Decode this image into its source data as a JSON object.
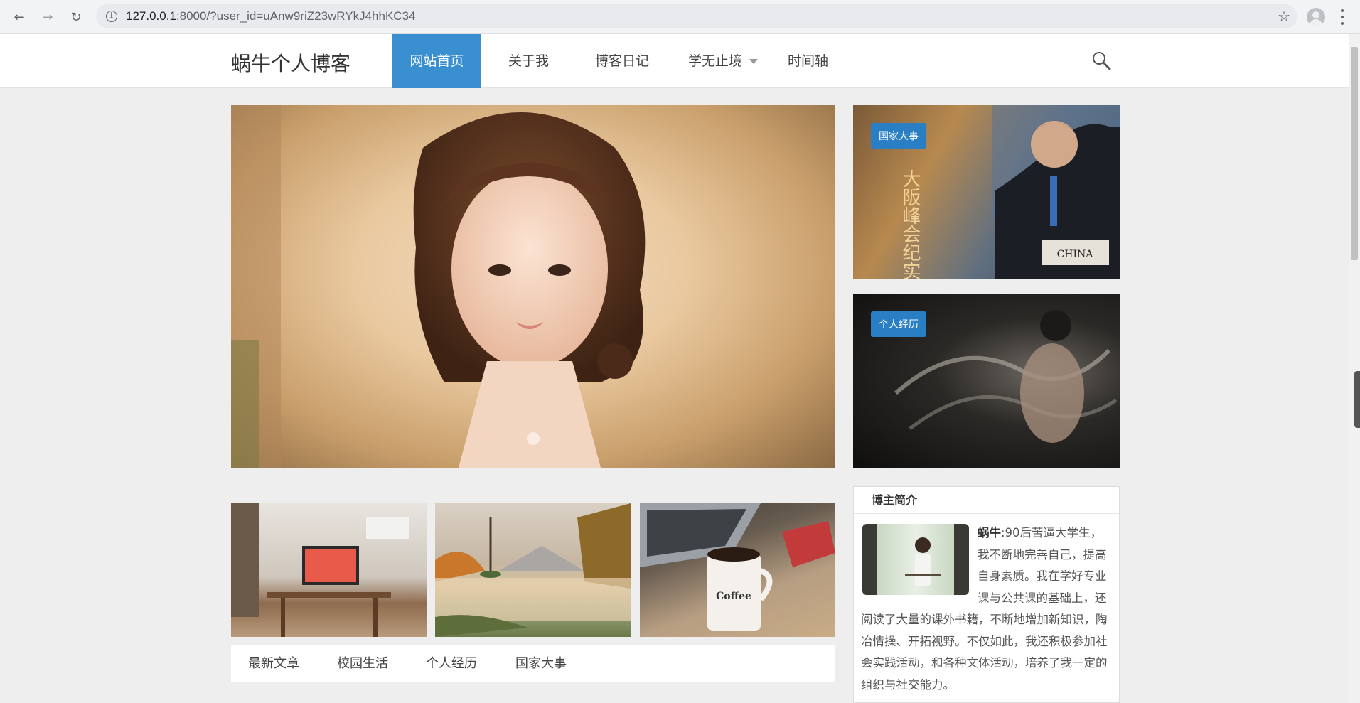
{
  "browser": {
    "url_host": "127.0.0.1",
    "url_rest": ":8000/?user_id=uAnw9riZ23wRYkJ4hhKC34"
  },
  "header": {
    "logo": "蜗牛个人博客",
    "nav": [
      {
        "label": "网站首页",
        "active": true
      },
      {
        "label": "关于我"
      },
      {
        "label": "博客日记"
      },
      {
        "label": "学无止境",
        "has_dropdown": true
      },
      {
        "label": "时间轴"
      }
    ]
  },
  "hero": {
    "image": "portrait-photo",
    "slide_indicator_count": 1
  },
  "side_cards": [
    {
      "tag": "国家大事",
      "image_text_vertical": "大阪峰会纪实",
      "image_text_sign": "CHINA"
    },
    {
      "tag": "个人经历"
    }
  ],
  "thumbnails": [
    "desk-workspace",
    "lake-watercolor",
    "coffee-mug"
  ],
  "thumbnail_texts": {
    "coffee": "Coffee"
  },
  "categories": [
    "最新文章",
    "校园生活",
    "个人经历",
    "国家大事"
  ],
  "about": {
    "title": "博主简介",
    "name": "蜗牛",
    "text": ":90后苦逼大学生，我不断地完善自己，提高自身素质。我在学好专业课与公共课的基础上，还阅读了大量的课外书籍，不断地增加新知识，陶冶情操、开拓视野。不仅如此，我还积极参加社会实践活动，和各种文体活动，培养了我一定的组织与社交能力。"
  }
}
